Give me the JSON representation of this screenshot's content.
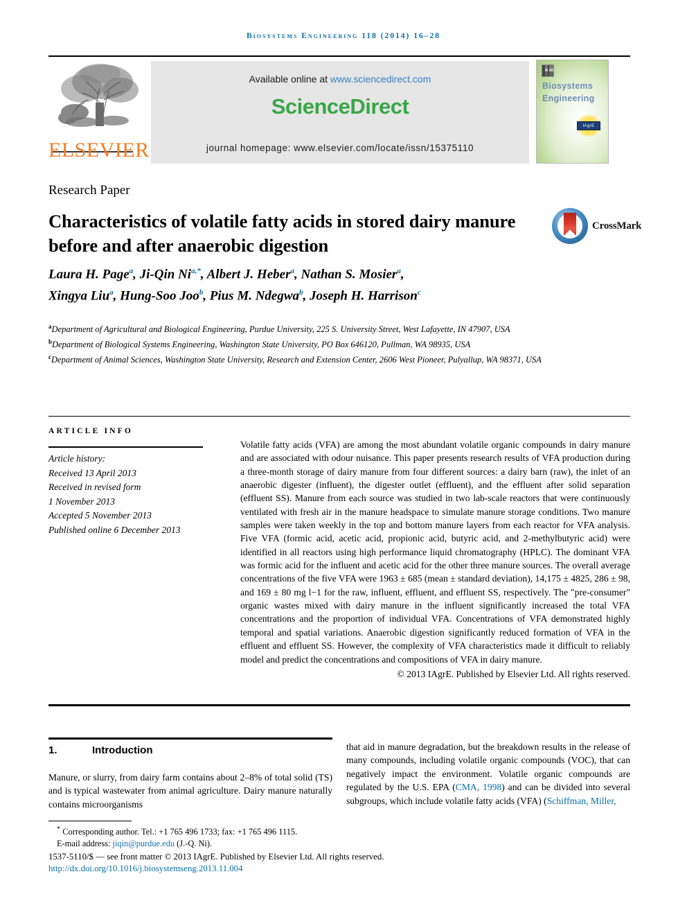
{
  "running_head": "Biosystems Engineering 118 (2014) 16–28",
  "masthead": {
    "available_prefix": "Available online at ",
    "available_url": "www.sciencedirect.com",
    "sciencedirect_logo": "ScienceDirect",
    "journal_homepage": "journal homepage: www.elsevier.com/locate/issn/15375110",
    "publisher_name": "ELSEVIER",
    "cover": {
      "line1": "Biosystems",
      "line2": "Engineering",
      "badge": "IAgrE"
    }
  },
  "article": {
    "paper_type": "Research Paper",
    "title": "Characteristics of volatile fatty acids in stored dairy manure before and after anaerobic digestion",
    "crossmark_label": "CrossMark",
    "authors_line1": "Laura H. Page a, Ji-Qin Ni a,*, Albert J. Heber a, Nathan S. Mosier a,",
    "authors_line2": "Xingya Liu a, Hung-Soo Joo b, Pius M. Ndegwa b, Joseph H. Harrison c",
    "affiliations": [
      "Department of Agricultural and Biological Engineering, Purdue University, 225 S. University Street, West Lafayette, IN 47907, USA",
      "Department of Biological Systems Engineering, Washington State University, PO Box 646120, Pullman, WA 98935, USA",
      "Department of Animal Sciences, Washington State University, Research and Extension Center, 2606 West Pioneer, Pulyallup, WA 98371, USA"
    ],
    "affiliation_marks": [
      "a",
      "b",
      "c"
    ]
  },
  "article_info": {
    "heading": "ARTICLE INFO",
    "history_label": "Article history:",
    "received": "Received 13 April 2013",
    "revised_label": "Received in revised form",
    "revised_date": "1 November 2013",
    "accepted": "Accepted 5 November 2013",
    "published": "Published online 6 December 2013"
  },
  "abstract": {
    "text": "Volatile fatty acids (VFA) are among the most abundant volatile organic compounds in dairy manure and are associated with odour nuisance. This paper presents research results of VFA production during a three-month storage of dairy manure from four different sources: a dairy barn (raw), the inlet of an anaerobic digester (influent), the digester outlet (effluent), and the effluent after solid separation (effluent SS). Manure from each source was studied in two lab-scale reactors that were continuously ventilated with fresh air in the manure headspace to simulate manure storage conditions. Two manure samples were taken weekly in the top and bottom manure layers from each reactor for VFA analysis. Five VFA (formic acid, acetic acid, propionic acid, butyric acid, and 2-methylbutyric acid) were identified in all reactors using high performance liquid chromatography (HPLC). The dominant VFA was formic acid for the influent and acetic acid for the other three manure sources. The overall average concentrations of the five VFA were 1963 ± 685 (mean ± standard deviation), 14,175 ± 4825, 286 ± 98, and 169 ± 80 mg l−1 for the raw, influent, effluent, and effluent SS, respectively. The \"pre-consumer\" organic wastes mixed with dairy manure in the influent significantly increased the total VFA concentrations and the proportion of individual VFA. Concentrations of VFA demonstrated highly temporal and spatial variations. Anaerobic digestion significantly reduced formation of VFA in the effluent and effluent SS. However, the complexity of VFA characteristics made it difficult to reliably model and predict the concentrations and compositions of VFA in dairy manure.",
    "copyright": "© 2013 IAgrE. Published by Elsevier Ltd. All rights reserved."
  },
  "body": {
    "section_number": "1.",
    "section_title": "Introduction",
    "left_column": "Manure, or slurry, from dairy farm contains about 2–8% of total solid (TS) and is typical wastewater from animal agriculture. Dairy manure naturally contains microorganisms",
    "right_column_part1": "that aid in manure degradation, but the breakdown results in the release of many compounds, including volatile organic compounds (VOC), that can negatively impact the environment. Volatile organic compounds are regulated by the U.S. EPA (",
    "right_citation1": "CMA, 1998",
    "right_column_part2": ") and can be divided into several subgroups, which include volatile fatty acids (VFA) (",
    "right_citation2": "Schiffman, Miller,"
  },
  "footer": {
    "corresponding_marker": "*",
    "corresponding_text": "Corresponding author. Tel.: +1 765 496 1733; fax: +1 765 496 1115.",
    "email_label": "E-mail address: ",
    "email": "jiqin@purdue.edu",
    "email_suffix": " (J.-Q. Ni).",
    "issn_line": "1537-5110/$ — see front matter © 2013 IAgrE. Published by Elsevier Ltd. All rights reserved.",
    "doi": "http://dx.doi.org/10.1016/j.biosystemseng.2013.11.004"
  },
  "colors": {
    "link_blue": "#0b6ea8",
    "sciencedirect_green": "#3aa648",
    "elsevier_orange": "#F47C20",
    "sd_link": "#3a7fc1"
  }
}
